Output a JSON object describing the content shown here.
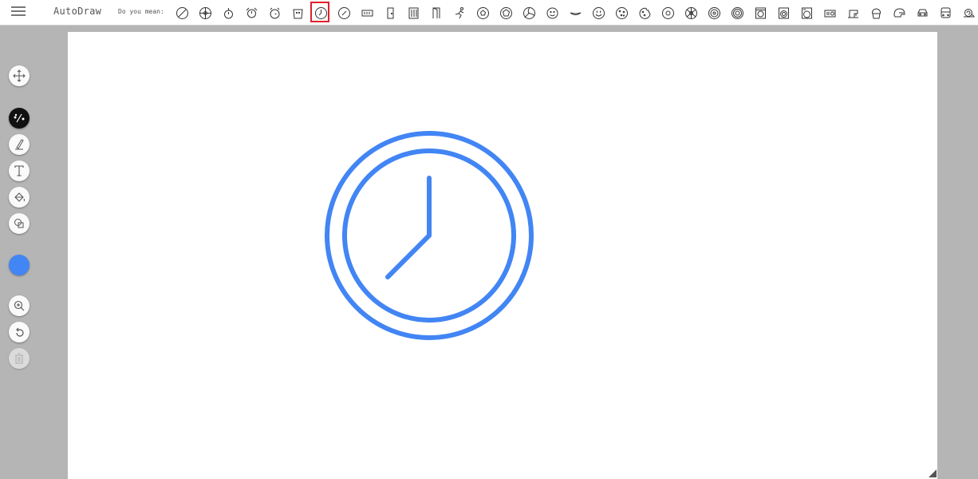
{
  "app": {
    "title": "AutoDraw"
  },
  "suggestions_bar": {
    "prompt": "Do you mean:",
    "items": [
      {
        "name": "clock-slash",
        "selected": false
      },
      {
        "name": "steering-wheel",
        "selected": false
      },
      {
        "name": "stopwatch-small",
        "selected": false
      },
      {
        "name": "alarm-clock-bells",
        "selected": false
      },
      {
        "name": "alarm-clock",
        "selected": false
      },
      {
        "name": "bucket-face",
        "selected": false
      },
      {
        "name": "clock",
        "selected": true
      },
      {
        "name": "clock-alt",
        "selected": false
      },
      {
        "name": "digital-display",
        "selected": false
      },
      {
        "name": "door",
        "selected": false
      },
      {
        "name": "building",
        "selected": false
      },
      {
        "name": "doorway",
        "selected": false
      },
      {
        "name": "runner",
        "selected": false
      },
      {
        "name": "soccer-ball",
        "selected": false
      },
      {
        "name": "ball-pentagon",
        "selected": false
      },
      {
        "name": "volleyball",
        "selected": false
      },
      {
        "name": "smiley-face",
        "selected": false
      },
      {
        "name": "mouth",
        "selected": false
      },
      {
        "name": "happy-face",
        "selected": false
      },
      {
        "name": "cookie",
        "selected": false
      },
      {
        "name": "cookie-bitten",
        "selected": false
      },
      {
        "name": "donut",
        "selected": false
      },
      {
        "name": "wheel",
        "selected": false
      },
      {
        "name": "wheel-spoked",
        "selected": false
      },
      {
        "name": "wheel-tire",
        "selected": false
      },
      {
        "name": "washing-machine",
        "selected": false
      },
      {
        "name": "washer",
        "selected": false
      },
      {
        "name": "washer-front",
        "selected": false
      },
      {
        "name": "radio",
        "selected": false
      },
      {
        "name": "sewing-machine",
        "selected": false
      },
      {
        "name": "cupcake",
        "selected": false
      },
      {
        "name": "helmet",
        "selected": false
      },
      {
        "name": "car-front",
        "selected": false
      },
      {
        "name": "bus-front",
        "selected": false
      },
      {
        "name": "snail",
        "selected": false
      }
    ]
  },
  "toolbar": {
    "tools": [
      {
        "id": "move",
        "icon": "move-arrows-icon",
        "active": false,
        "disabled": false
      },
      {
        "id": "autodraw",
        "icon": "autodraw-pen-icon",
        "active": true,
        "disabled": false
      },
      {
        "id": "draw",
        "icon": "pencil-icon",
        "active": false,
        "disabled": false
      },
      {
        "id": "type",
        "icon": "text-icon",
        "active": false,
        "disabled": false
      },
      {
        "id": "fill",
        "icon": "paint-bucket-icon",
        "active": false,
        "disabled": false
      },
      {
        "id": "shape",
        "icon": "shapes-icon",
        "active": false,
        "disabled": false
      },
      {
        "id": "zoom",
        "icon": "zoom-icon",
        "active": false,
        "disabled": false
      },
      {
        "id": "undo",
        "icon": "undo-icon",
        "active": false,
        "disabled": false
      },
      {
        "id": "delete",
        "icon": "trash-icon",
        "active": false,
        "disabled": true
      }
    ],
    "selected_color": "#4285f4"
  },
  "canvas": {
    "drawing": "clock",
    "stroke_color": "#4285f4"
  }
}
